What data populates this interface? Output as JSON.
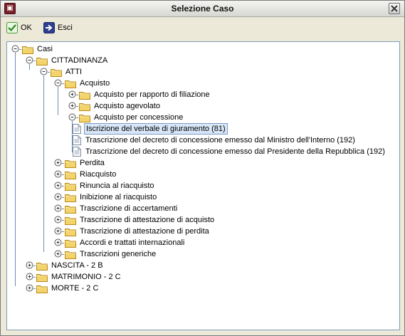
{
  "window": {
    "title": "Selezione Caso",
    "app_icon": "app-logo-icon",
    "close_icon": "close-icon"
  },
  "toolbar": {
    "ok_label": "OK",
    "ok_icon": "checkmark-icon",
    "exit_label": "Esci",
    "exit_icon": "exit-arrow-icon"
  },
  "tree": {
    "root": "Casi",
    "cittadinanza": "CITTADINANZA",
    "atti": "ATTI",
    "acquisto": "Acquisto",
    "acquisto_children": [
      "Acquisto per rapporto di filiazione",
      "Acquisto agevolato",
      "Acquisto per concessione"
    ],
    "concessione_docs": [
      "Iscrizione del verbale di giuramento (81)",
      "Trascrizione del decreto di concessione emesso dal Ministro dell'Interno (192)",
      "Trascrizione del decreto di concessione emesso dal Presidente della Repubblica (192)"
    ],
    "selected_doc_index": 0,
    "atti_children": [
      "Perdita",
      "Riacquisto",
      "Rinuncia al riacquisto",
      "Inibizione al riacquisto",
      "Trascrizione di accertamenti",
      "Trascrizione di attestazione di acquisto",
      "Trascrizione di attestazione di perdita",
      "Accordi e trattati internazionali",
      "Trascrizioni generiche"
    ],
    "top_level": [
      "NASCITA - 2 B",
      "MATRIMONIO - 2 C",
      "MORTE - 2 C"
    ]
  },
  "colors": {
    "folder_fill": "#f3d46a",
    "folder_stroke": "#b88a1a",
    "tree_line": "#6e8eb3",
    "selection_bg": "#d8e6f8",
    "selection_border": "#7c9bc9"
  }
}
